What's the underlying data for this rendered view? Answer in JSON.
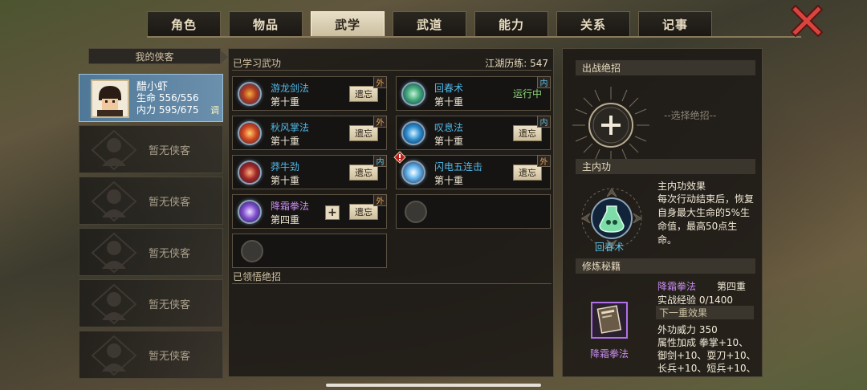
{
  "tabs": [
    "角色",
    "物品",
    "武学",
    "武道",
    "能力",
    "关系",
    "记事"
  ],
  "active_tab": "武学",
  "sidebar": {
    "header": "我的侠客",
    "selected_hero": {
      "name": "醋小虾",
      "hp_label": "生命",
      "hp": "556/556",
      "mp_label": "内力",
      "mp": "595/675",
      "tag": "调"
    },
    "empty_slot_text": "暂无侠客"
  },
  "center": {
    "learned_title": "已学习武功",
    "jianghu_label": "江湖历练:",
    "jianghu_value": "547",
    "skills": [
      {
        "name": "游龙剑法",
        "level": "第十重",
        "action": "遗忘",
        "type": "外",
        "color": "#4fb8e8"
      },
      {
        "name": "回春术",
        "level": "第十重",
        "status": "运行中",
        "type": "内",
        "color": "#4fb8e8"
      },
      {
        "name": "秋风掌法",
        "level": "第十重",
        "action": "遗忘",
        "type": "外",
        "color": "#4fb8e8"
      },
      {
        "name": "叹息法",
        "level": "第十重",
        "action": "遗忘",
        "type": "内",
        "color": "#4fb8e8"
      },
      {
        "name": "莽牛劲",
        "level": "第十重",
        "action": "遗忘",
        "type": "内",
        "color": "#4fb8e8"
      },
      {
        "name": "闪电五连击",
        "level": "第十重",
        "action": "遗忘",
        "type": "外",
        "color": "#4fb8e8"
      },
      {
        "name": "降霜拳法",
        "level": "第四重",
        "action": "遗忘",
        "type": "外",
        "color": "#c78cf0",
        "plus": "+"
      }
    ],
    "comprehended_title": "已领悟绝招"
  },
  "right": {
    "ult_header": "出战绝招",
    "ult_placeholder": "--选择绝招--",
    "main_inner_header": "主内功",
    "main_inner_name": "回春术",
    "effect_title": "主内功效果",
    "effect_desc": "每次行动结束后，恢复自身最大生命的5%生命值，最高50点生命。",
    "manual_header": "修炼秘籍",
    "manual_name": "降霜拳法",
    "manual_skill": "降霜拳法",
    "manual_level": "第四重",
    "manual_exp": "实战经验 0/1400",
    "next_level_header": "下一重效果",
    "next_lines": [
      "外功威力 350",
      "属性加成  拳掌+10、",
      "御剑+10、耍刀+10、",
      "长兵+10、短兵+10、"
    ]
  }
}
